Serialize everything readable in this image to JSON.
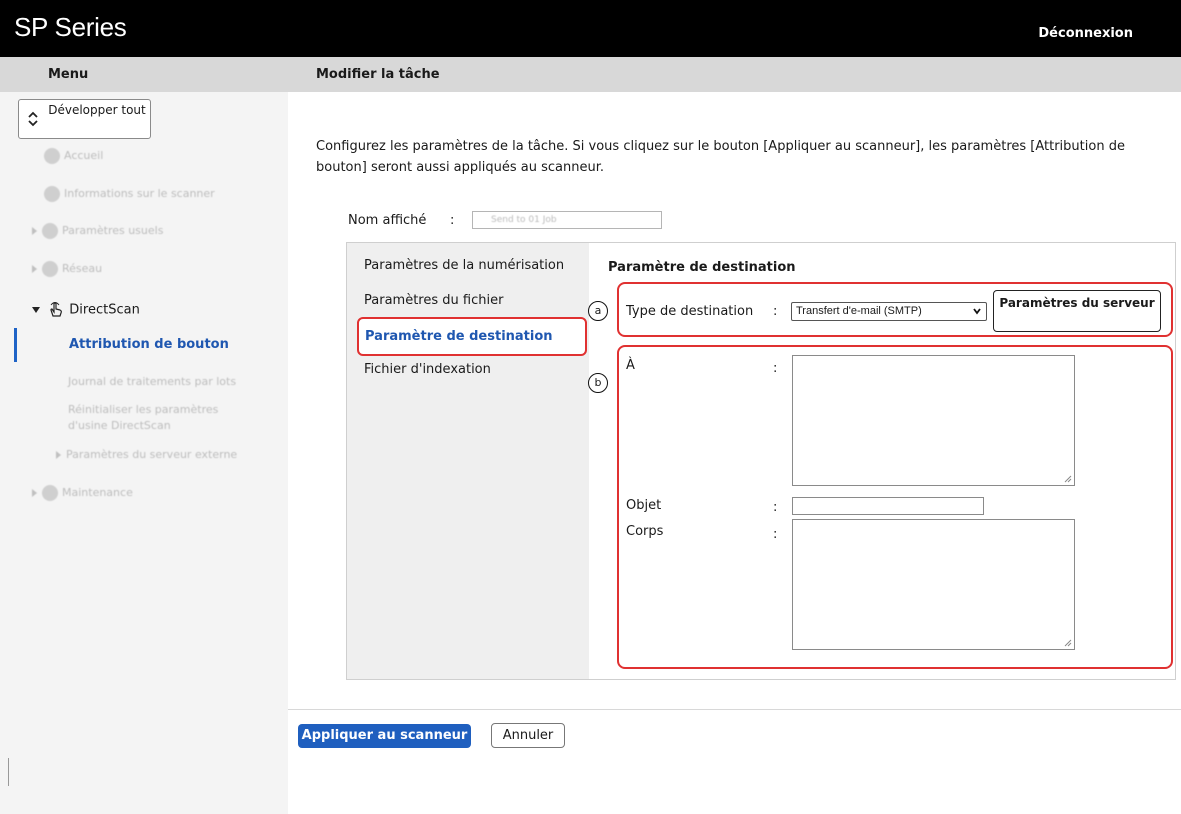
{
  "app": {
    "title": "SP Series",
    "logout_label": "Déconnexion"
  },
  "subbar": {
    "menu_title": "Menu",
    "page_title": "Modifier la tâche"
  },
  "sidebar": {
    "expand_button_label": "Développer tout",
    "items": [
      {
        "label": "Accueil",
        "icon": "home-icon"
      },
      {
        "label": "Informations sur le scanner",
        "icon": "info-icon"
      },
      {
        "label": "Paramètres usuels",
        "icon": "gear-icon"
      },
      {
        "label": "Réseau",
        "icon": "network-icon"
      },
      {
        "label": "DirectScan",
        "icon": "hand-pointer-icon"
      },
      {
        "label": "Attribution de bouton"
      },
      {
        "label": "Journal de traitements par lots"
      },
      {
        "label": "Réinitialiser les paramètres d'usine DirectScan"
      },
      {
        "label": "Paramètres du serveur externe"
      },
      {
        "label": "Maintenance",
        "icon": "wrench-icon"
      }
    ]
  },
  "main": {
    "description": "Configurez les paramètres de la tâche. Si vous cliquez sur le bouton [Appliquer au scanneur], les paramètres [Attribution de bouton] seront aussi appliqués au scanneur.",
    "display_name_label": "Nom affiché",
    "display_name_value": "Send to 01 Job",
    "colon": ":",
    "tabs": [
      {
        "label": "Paramètres de la numérisation"
      },
      {
        "label": "Paramètres du fichier"
      },
      {
        "label": "Paramètre de destination"
      },
      {
        "label": "Fichier d'indexation"
      }
    ],
    "section_title": "Paramètre de destination",
    "callouts": {
      "a": "a",
      "b": "b"
    },
    "destination_type_label": "Type de destination",
    "destination_type_value": "Transfert d'e-mail (SMTP)",
    "server_settings_label": "Paramètres du serveur",
    "to_label": "À",
    "subject_label": "Objet",
    "body_label": "Corps"
  },
  "footer": {
    "apply_label": "Appliquer au scanneur",
    "cancel_label": "Annuler"
  },
  "colors": {
    "accent": "#1f5fbf",
    "highlight": "#e03131",
    "header_bg": "#000000"
  }
}
